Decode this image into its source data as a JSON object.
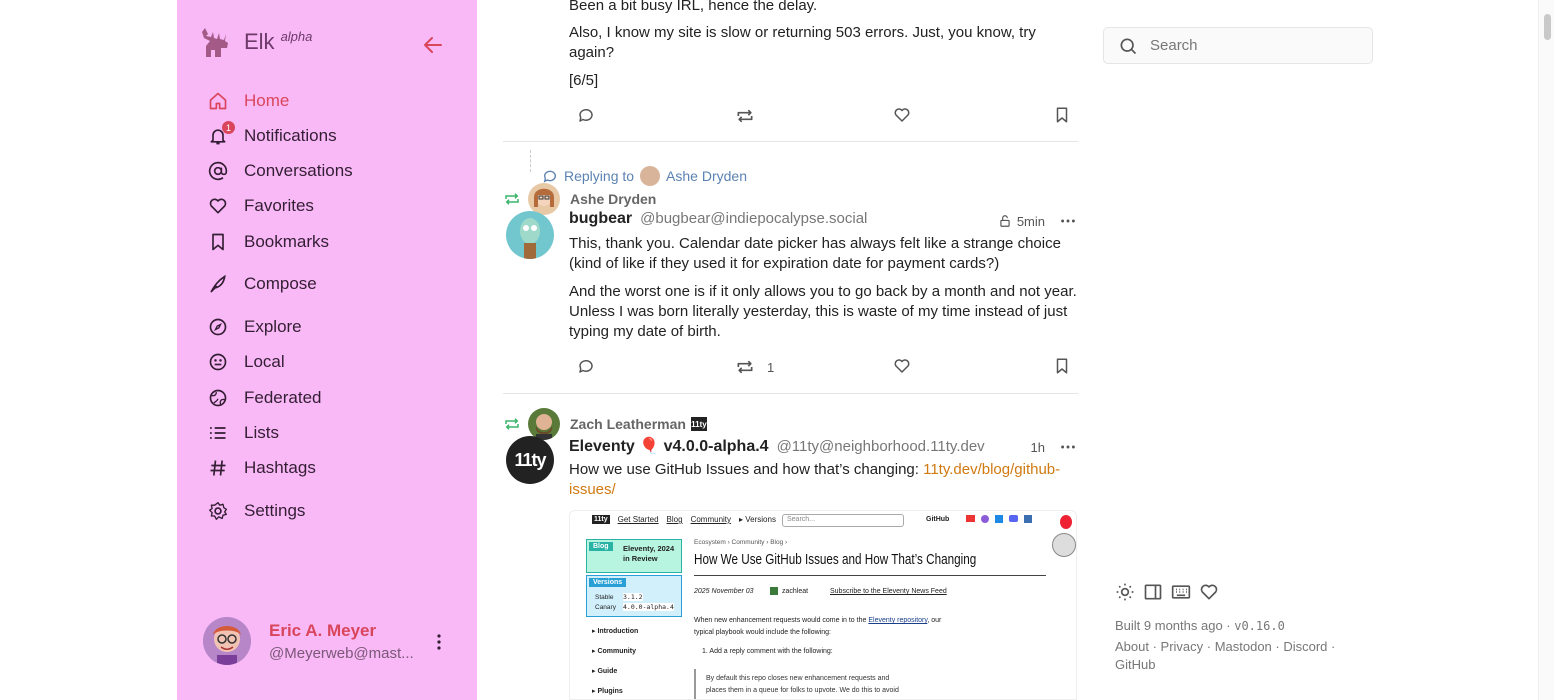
{
  "app": {
    "name": "Elk",
    "tag": "alpha"
  },
  "sidebar": {
    "items": [
      {
        "label": "Home",
        "icon": "home-icon",
        "active": true
      },
      {
        "label": "Notifications",
        "icon": "bell-icon",
        "badge": "1"
      },
      {
        "label": "Conversations",
        "icon": "at-icon"
      },
      {
        "label": "Favorites",
        "icon": "heart-icon"
      },
      {
        "label": "Bookmarks",
        "icon": "bookmark-icon"
      },
      {
        "label": "Compose",
        "icon": "feather-icon"
      },
      {
        "label": "Explore",
        "icon": "compass-icon"
      },
      {
        "label": "Local",
        "icon": "local-icon"
      },
      {
        "label": "Federated",
        "icon": "globe-icon"
      },
      {
        "label": "Lists",
        "icon": "list-icon"
      },
      {
        "label": "Hashtags",
        "icon": "hash-icon"
      },
      {
        "label": "Settings",
        "icon": "gear-icon"
      }
    ]
  },
  "profile": {
    "name": "Eric A. Meyer",
    "handle": "@Meyerweb@mast..."
  },
  "timeline": {
    "post1": {
      "lines": [
        "Been a bit busy IRL, hence the delay.",
        "Also, I know my site is slow or returning 503 errors. Just, you know, try again?",
        "[6/5]"
      ]
    },
    "post2": {
      "replying_label": "Replying to",
      "replying_to": "Ashe Dryden",
      "boosted_by": "Ashe Dryden",
      "display_name": "bugbear",
      "handle": "@bugbear@indiepocalypse.social",
      "time": "5min",
      "para1": "This, thank you.  Calendar date picker has always felt like a strange choice (kind of like if they used it for expiration date for payment cards?)",
      "para2": "And the worst one is if it only allows you to go back by a month and not year. Unless I was born literally yesterday, this is waste of my time instead of just typing my date of birth.",
      "boost_count": "1"
    },
    "post3": {
      "boosted_by": "Zach Leatherman",
      "display_name": "Eleventy 🎈 v4.0.0-alpha.4",
      "handle": "@11ty@neighborhood.11ty.dev",
      "time": "1h",
      "text": "How we use GitHub Issues and how that’s changing: ",
      "link": "11ty.dev/blog/github-issues/",
      "embed": {
        "nav": [
          "Get Started",
          "Blog",
          "Community",
          "▸ Versions"
        ],
        "search_placeholder": "Search...",
        "github": "GitHub",
        "breadcrumb": "Ecosystem › Community › Blog ›",
        "blog_badge": "Blog",
        "blog_card": "Eleventy, 2024 in Review",
        "versions_badge": "Versions",
        "stable_label": "Stable",
        "stable_val": "3.1.2",
        "canary_label": "Canary",
        "canary_val": "4.0.0-alpha.4",
        "side_links": [
          "▸ Introduction",
          "▸ Community",
          "▸ Guide",
          "▸ Plugins"
        ],
        "title": "How We Use GitHub Issues and How That’s Changing",
        "date": "2025 November 03",
        "author": "zachleat",
        "subscribe": "Subscribe to the Eleventy News Feed",
        "body1": "When new enhancement requests would come in to the",
        "body1_link": "Eleventy repository",
        "body1_end": ", our",
        "body2": "typical playbook would include the following:",
        "list1": "1. Add a reply comment with the following:",
        "quote1": "By default this repo closes new enhancement requests and",
        "quote2": "places them in a queue for folks to upvote. We do this to avoid"
      }
    }
  },
  "search": {
    "placeholder": "Search"
  },
  "footer": {
    "built": "Built 9 months ago · ",
    "version": "v0.16.0",
    "links": "About · Privacy · Mastodon · Discord · GitHub"
  },
  "colors": {
    "sidebar": "#f9b9f7",
    "accent": "#d9465c",
    "link": "#d07a10",
    "boost": "#3bb36b"
  }
}
